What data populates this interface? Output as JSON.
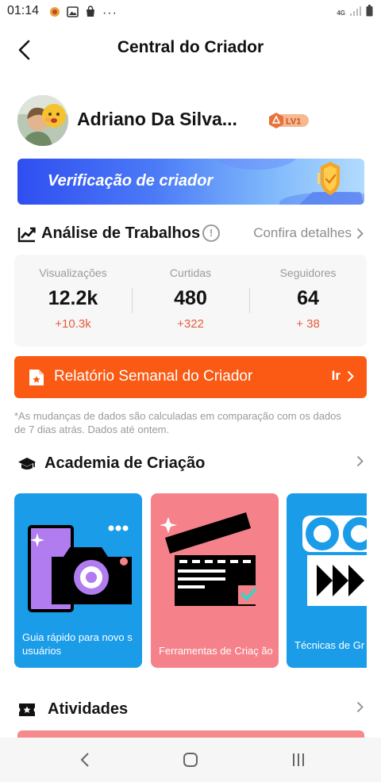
{
  "status_bar": {
    "time": "01:14",
    "more": "···",
    "network": "4G"
  },
  "header": {
    "title": "Central do Criador"
  },
  "profile": {
    "name": "Adriano Da Silva...",
    "level": "LV1"
  },
  "verification_banner": {
    "text": "Verificação de criador"
  },
  "analysis": {
    "title": "Análise de Trabalhos",
    "details_link": "Confira detalhes",
    "stats": [
      {
        "label": "Visualizações",
        "value": "12.2k",
        "delta": "+10.3k"
      },
      {
        "label": "Curtidas",
        "value": "480",
        "delta": "+322"
      },
      {
        "label": "Seguidores",
        "value": "64",
        "delta": "+ 38"
      }
    ]
  },
  "weekly_report": {
    "label": "Relatório Semanal do Criador",
    "action": "Ir"
  },
  "footnote": "*As mudanças de dados são calculadas em comparação com os dados de 7 dias atrás. Dados até ontem.",
  "academy": {
    "title": "Academia de Criação",
    "cards": [
      {
        "label": "Guia rápido para novo s usuários",
        "color": "#1a9ce9"
      },
      {
        "label": "Ferramentas de Criaç ão",
        "color": "#f5828a"
      },
      {
        "label": "Técnicas de Gr",
        "color": "#1a9ce9"
      }
    ]
  },
  "activities": {
    "title": "Atividades"
  },
  "colors": {
    "accent_orange": "#fa5a13",
    "delta_red": "#e65a3b",
    "banner_blue": "#2f4ef0"
  }
}
